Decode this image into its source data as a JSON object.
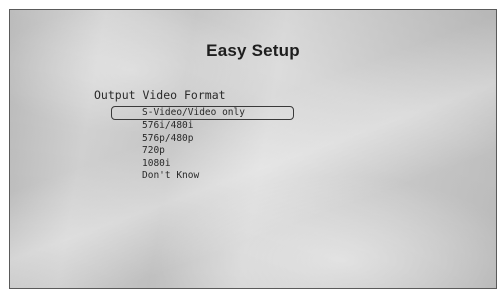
{
  "screen": {
    "title": "Easy Setup",
    "section_heading": "Output Video Format",
    "options": [
      {
        "label": "S-Video/Video only",
        "selected": true
      },
      {
        "label": "576i/480i",
        "selected": false
      },
      {
        "label": "576p/480p",
        "selected": false
      },
      {
        "label": "720p",
        "selected": false
      },
      {
        "label": "1080i",
        "selected": false
      },
      {
        "label": "Don't Know",
        "selected": false
      }
    ]
  },
  "colors": {
    "text": "#2a2a2a",
    "title": "#1e1e1e",
    "highlight_border": "#3a3a3a"
  }
}
